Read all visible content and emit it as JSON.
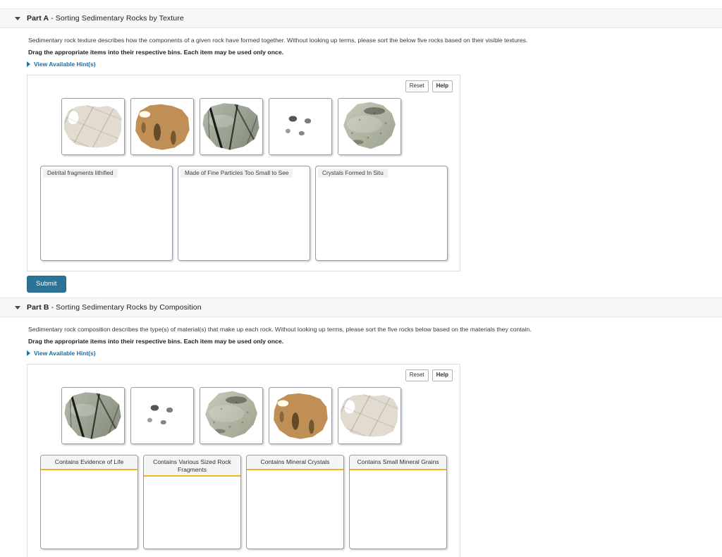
{
  "parts": [
    {
      "id": "part-a",
      "label": "Part A",
      "separator": " - ",
      "title": "Sorting Sedimentary Rocks by Texture",
      "description": "Sedimentary rock texture describes how the components of a given rock have formed together. Without looking up terms, please sort the below five rocks based on their visible textures.",
      "instruction": "Drag the appropriate items into their respective bins. Each item may be used only once.",
      "hint_label": "View Available Hint(s)",
      "toolbar": {
        "reset_label": "Reset",
        "help_label": "Help"
      },
      "items": [
        {
          "name": "halite-crystals-rock",
          "rock": "r-halite"
        },
        {
          "name": "coquina-shell-rock",
          "rock": "r-coquina"
        },
        {
          "name": "fossil-shale-rock",
          "rock": "r-shale"
        },
        {
          "name": "conglomerate-rock",
          "rock": "r-conglom"
        },
        {
          "name": "sandstone-rock",
          "rock": "r-sandstone"
        }
      ],
      "bins": [
        {
          "label": "Detrital fragments lithified"
        },
        {
          "label": "Made of Fine Particles Too Small to See"
        },
        {
          "label": "Crystals Formed In Situ"
        }
      ],
      "submit_label": "Submit"
    },
    {
      "id": "part-b",
      "label": "Part B",
      "separator": " - ",
      "title": "Sorting Sedimentary Rocks by Composition",
      "description": "Sedimentary rock composition describes the type(s) of material(s) that make up each rock. Without looking up terms, please sort the five rocks below based on the materials they contain.",
      "instruction": "Drag the appropriate items into their respective bins. Each item may be used only once.",
      "hint_label": "View Available Hint(s)",
      "toolbar": {
        "reset_label": "Reset",
        "help_label": "Help"
      },
      "items": [
        {
          "name": "fossil-shale-rock",
          "rock": "r-shale"
        },
        {
          "name": "conglomerate-rock",
          "rock": "r-conglom"
        },
        {
          "name": "sandstone-rock",
          "rock": "r-sandstone"
        },
        {
          "name": "coquina-shell-rock",
          "rock": "r-coquina"
        },
        {
          "name": "halite-crystals-rock",
          "rock": "r-halite"
        }
      ],
      "bins": [
        {
          "label": "Contains Evidence of Life"
        },
        {
          "label": "Contains Various Sized Rock Fragments"
        },
        {
          "label": "Contains Mineral Crystals"
        },
        {
          "label": "Contains Small Mineral Grains"
        }
      ]
    }
  ],
  "colors": {
    "accent_link": "#1c6ca5",
    "submit_bg": "#2b7397",
    "bin_underline": "#f0b323",
    "header_bg": "#f7f7f7"
  }
}
